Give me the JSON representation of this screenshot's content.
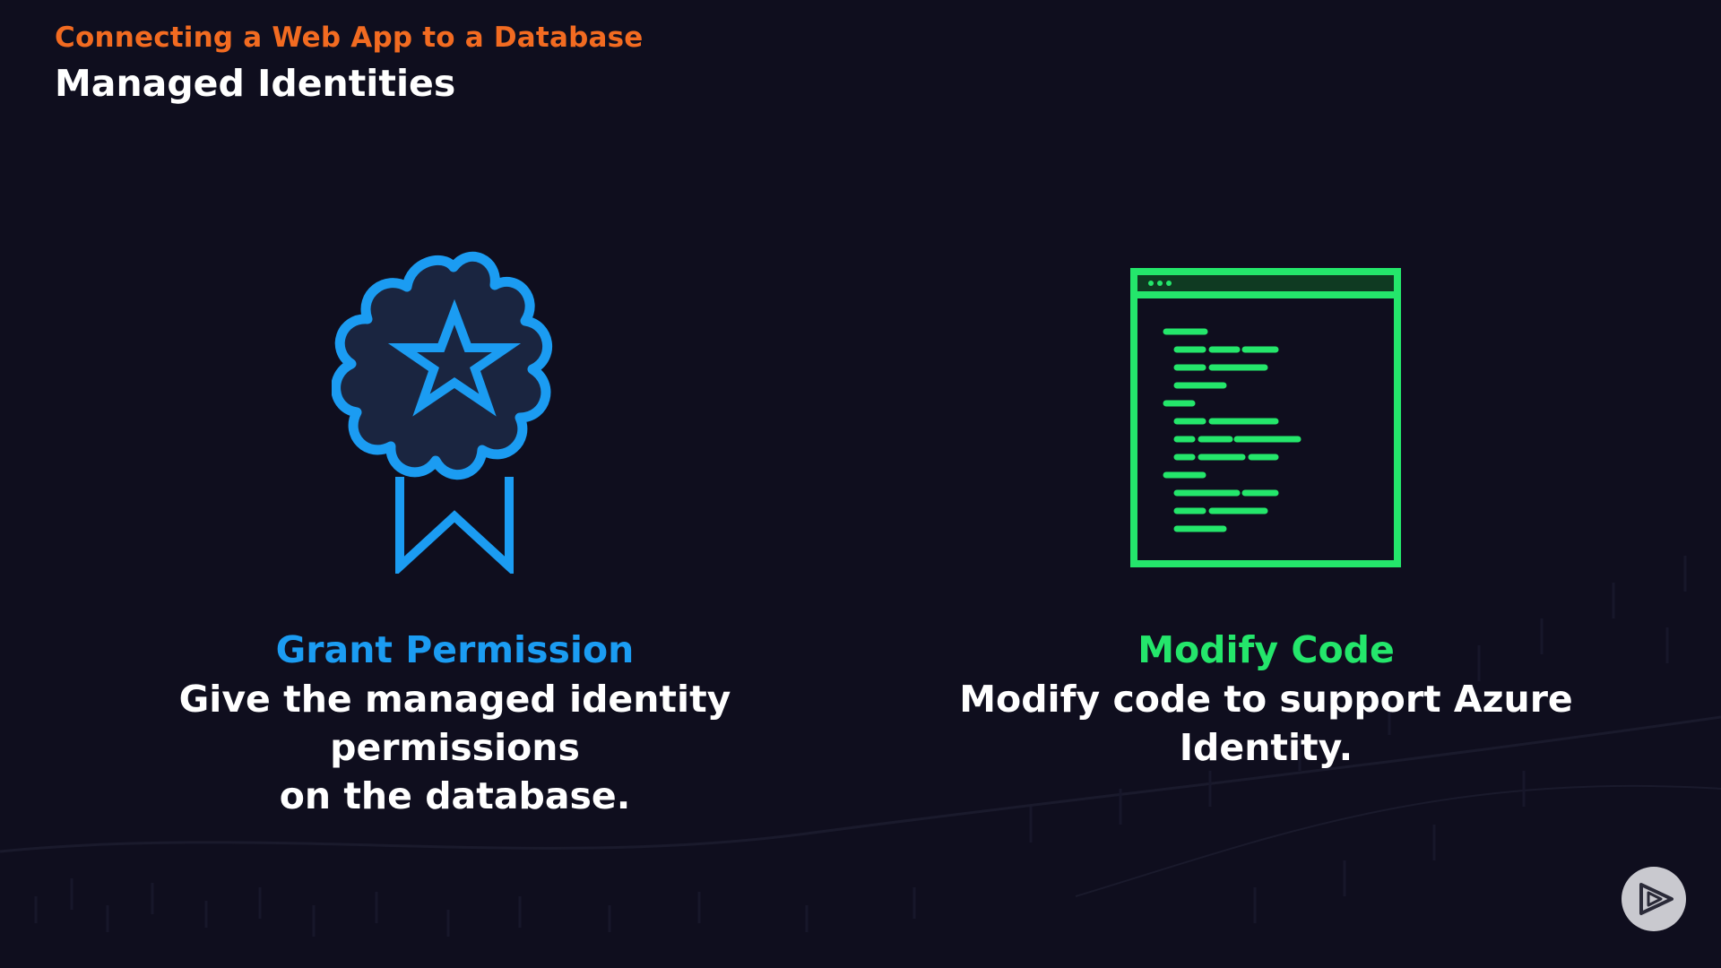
{
  "header": {
    "eyebrow": "Connecting a Web App to a Database",
    "title": "Managed Identities"
  },
  "left": {
    "title": "Grant Permission",
    "description_line1": "Give the managed identity permissions",
    "description_line2": "on the database.",
    "icon": "award-ribbon-icon"
  },
  "right": {
    "title": "Modify Code",
    "description": "Modify code to support Azure Identity.",
    "icon": "code-window-icon"
  },
  "controls": {
    "play_icon": "play-icon"
  },
  "colors": {
    "background": "#0f0e1e",
    "accent_orange": "#f26b21",
    "accent_blue": "#1b9cf2",
    "accent_green": "#24e66b"
  }
}
